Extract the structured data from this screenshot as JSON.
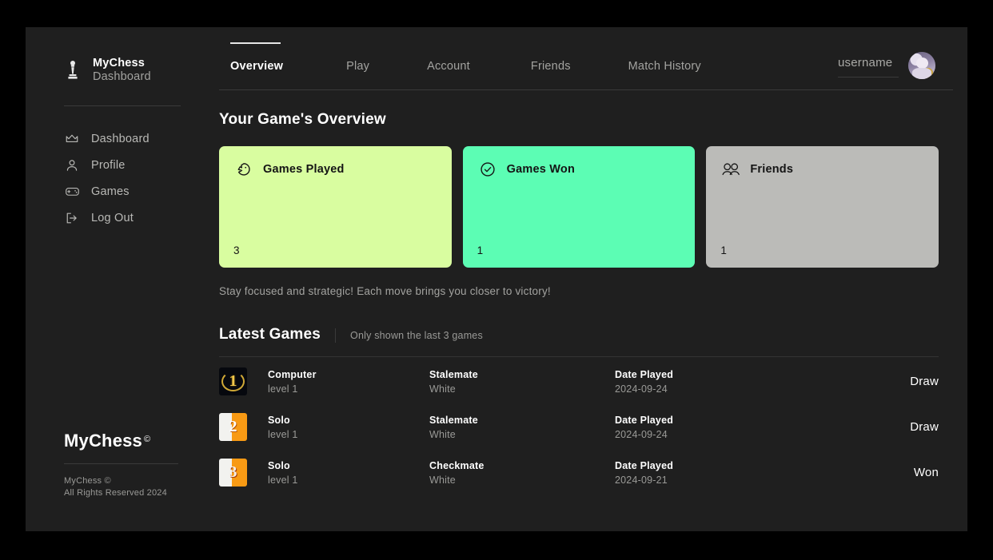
{
  "brand": {
    "icon": "chess-pawn-icon",
    "title": "MyChess",
    "subtitle": "Dashboard"
  },
  "sidebar": {
    "items": [
      {
        "label": "Dashboard",
        "icon": "crown-icon"
      },
      {
        "label": "Profile",
        "icon": "user-icon"
      },
      {
        "label": "Games",
        "icon": "gamepad-icon"
      },
      {
        "label": "Log Out",
        "icon": "logout-icon"
      }
    ],
    "footer": {
      "logo": "MyChess",
      "logo_mark": "©",
      "line1": "MyChess ©",
      "line2": "All Rights Reserved 2024"
    }
  },
  "topbar": {
    "tabs": [
      {
        "label": "Overview",
        "active": true
      },
      {
        "label": "Play",
        "active": false
      },
      {
        "label": "Account",
        "active": false
      },
      {
        "label": "Friends",
        "active": false
      },
      {
        "label": "Match History",
        "active": false
      }
    ],
    "username": "username",
    "avatar_alt": "user-avatar"
  },
  "main": {
    "overview_title": "Your Game's Overview",
    "motivation": "Stay focused and strategic! Each move brings you closer to victory!",
    "stats": [
      {
        "label": "Games Played",
        "value": "3",
        "icon": "knight-icon",
        "color": "#d9fda0"
      },
      {
        "label": "Games Won",
        "value": "1",
        "icon": "check-circle-icon",
        "color": "#5cfdb4"
      },
      {
        "label": "Friends",
        "value": "1",
        "icon": "people-icon",
        "color": "#bbbbb8"
      }
    ],
    "latest": {
      "title": "Latest Games",
      "note": "Only shown the last 3 games",
      "rows": [
        {
          "thumb": "badge-1-thumbnail",
          "thumb_num": "1",
          "thumb_style": "gold",
          "opponent": "Computer",
          "level": "level 1",
          "type": "Stalemate",
          "side": "White",
          "date_label": "Date Played",
          "date": "2024-09-24",
          "result": "Draw"
        },
        {
          "thumb": "badge-2-thumbnail",
          "thumb_num": "2",
          "thumb_style": "orange",
          "opponent": "Solo",
          "level": "level 1",
          "type": "Stalemate",
          "side": "White",
          "date_label": "Date Played",
          "date": "2024-09-24",
          "result": "Draw"
        },
        {
          "thumb": "badge-3-thumbnail",
          "thumb_num": "3",
          "thumb_style": "orange-red",
          "opponent": "Solo",
          "level": "level 1",
          "type": "Checkmate",
          "side": "White",
          "date_label": "Date Played",
          "date": "2024-09-21",
          "result": "Won"
        }
      ]
    }
  },
  "colors": {
    "page_bg": "#000000",
    "panel_bg": "#1f1f1f",
    "accent_lime": "#d9fda0",
    "accent_mint": "#5cfdb4",
    "accent_gray": "#bbbbb8",
    "text_primary": "#ffffff",
    "text_muted": "#9a9a97"
  }
}
